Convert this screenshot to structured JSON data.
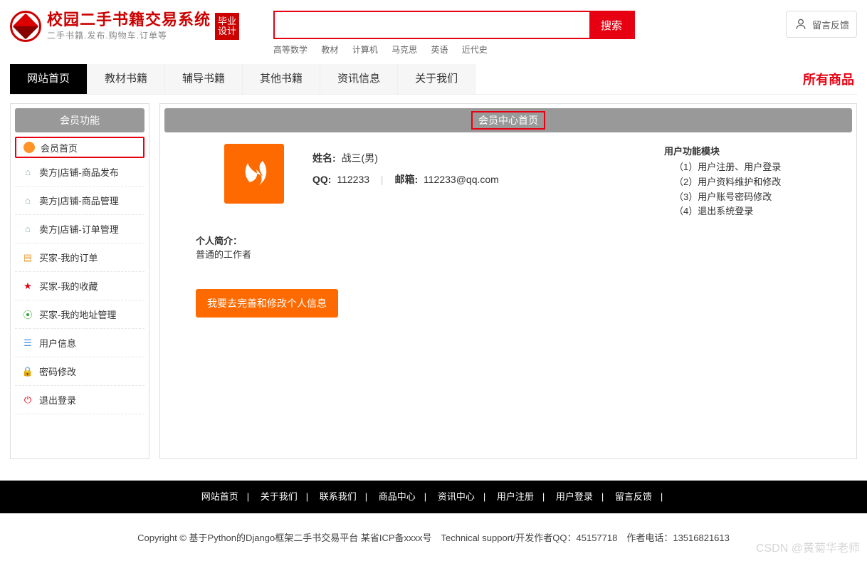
{
  "header": {
    "title": "校园二手书籍交易系统",
    "subtitle": "二手书籍.发布.购物车.订单等",
    "badge_l1": "毕业",
    "badge_l2": "设计",
    "search_placeholder": "",
    "search_btn": "搜索",
    "tags": [
      "高等数学",
      "教材",
      "计算机",
      "马克思",
      "英语",
      "近代史"
    ],
    "feedback": "留言反馈"
  },
  "nav": {
    "items": [
      "网站首页",
      "教材书籍",
      "辅导书籍",
      "其他书籍",
      "资讯信息",
      "关于我们"
    ],
    "right": "所有商品"
  },
  "sidebar": {
    "title": "会员功能",
    "items": [
      "会员首页",
      "卖方|店铺-商品发布",
      "卖方|店铺-商品管理",
      "卖方|店铺-订单管理",
      "买家-我的订单",
      "买家-我的收藏",
      "买家-我的地址管理",
      "用户信息",
      "密码修改",
      "退出登录"
    ]
  },
  "content": {
    "head": "会员中心首页",
    "name_lbl": "姓名:",
    "name_val": "战三(男)",
    "qq_lbl": "QQ:",
    "qq_val": "112233",
    "email_lbl": "邮箱:",
    "email_val": "112233@qq.com",
    "intro_lbl": "个人简介：",
    "intro_val": "普通的工作者",
    "edit_btn": "我要去完善和修改个人信息",
    "module_title": "用户功能模块",
    "modules": [
      "（1）用户注册、用户登录",
      "（2）用户资料维护和修改",
      "（3）用户账号密码修改",
      "（4）退出系统登录"
    ]
  },
  "footer": {
    "links": [
      "网站首页",
      "关于我们",
      "联系我们",
      "商品中心",
      "资讯中心",
      "用户注册",
      "用户登录",
      "留言反馈"
    ],
    "copy": "Copyright © 基于Python的Django框架二手书交易平台 某省ICP备xxxx号　Technical support/开发作者QQ：45157718　作者电话：13516821613"
  },
  "watermark": "CSDN @黄菊华老师"
}
